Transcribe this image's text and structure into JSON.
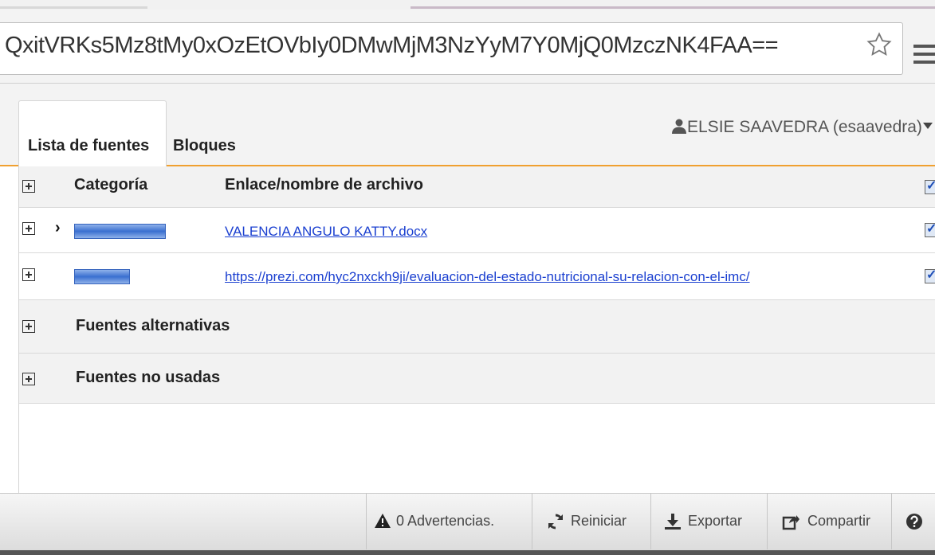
{
  "browser": {
    "url": "QxitVRKs5Mz8tMy0xOzEtOVbIy0DMwMjM3NzYyM7Y0MjQ0MzczNK4FAA=="
  },
  "tabs": [
    {
      "label": "Lista de fuentes",
      "active": true
    },
    {
      "label": "Bloques",
      "active": false
    }
  ],
  "user": {
    "label": "ELSIE SAAVEDRA (esaavedra)"
  },
  "table": {
    "headers": {
      "category": "Categoría",
      "link": "Enlace/nombre de archivo"
    },
    "rows": [
      {
        "category": "",
        "link": "VALENCIA ANGULO KATTY.docx",
        "checked": true
      },
      {
        "category": "",
        "link": "https://prezi.com/hyc2nxckh9ji/evaluacion-del-estado-nutricional-su-relacion-con-el-imc/",
        "checked": true
      }
    ],
    "groups": [
      {
        "label": "Fuentes alternativas"
      },
      {
        "label": "Fuentes no usadas"
      }
    ]
  },
  "bottombar": {
    "warnings": "0 Advertencias.",
    "reset": "Reiniciar",
    "export": "Exportar",
    "share": "Compartir"
  },
  "colors": {
    "accent": "#f0a030",
    "link": "#1a3fd0"
  }
}
